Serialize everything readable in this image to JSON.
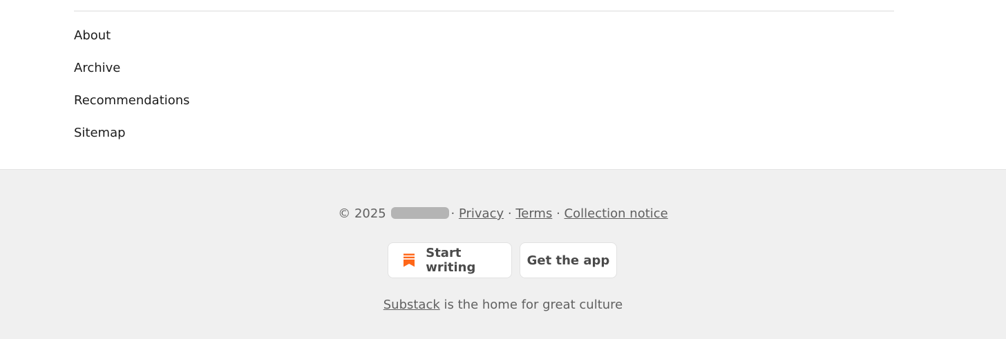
{
  "nav": {
    "items": [
      {
        "label": "About"
      },
      {
        "label": "Archive"
      },
      {
        "label": "Recommendations"
      },
      {
        "label": "Sitemap"
      }
    ]
  },
  "footer": {
    "copyright": "© 2025",
    "separator": "·",
    "links": {
      "privacy": "Privacy",
      "terms": "Terms",
      "collection_notice": "Collection notice"
    },
    "buttons": {
      "start_writing": "Start writing",
      "get_app": "Get the app"
    },
    "tagline": {
      "brand": "Substack",
      "text": " is the home for great culture"
    },
    "accent_color": "#ff6719",
    "icons": {
      "start_writing": "substack-logo-icon"
    }
  }
}
